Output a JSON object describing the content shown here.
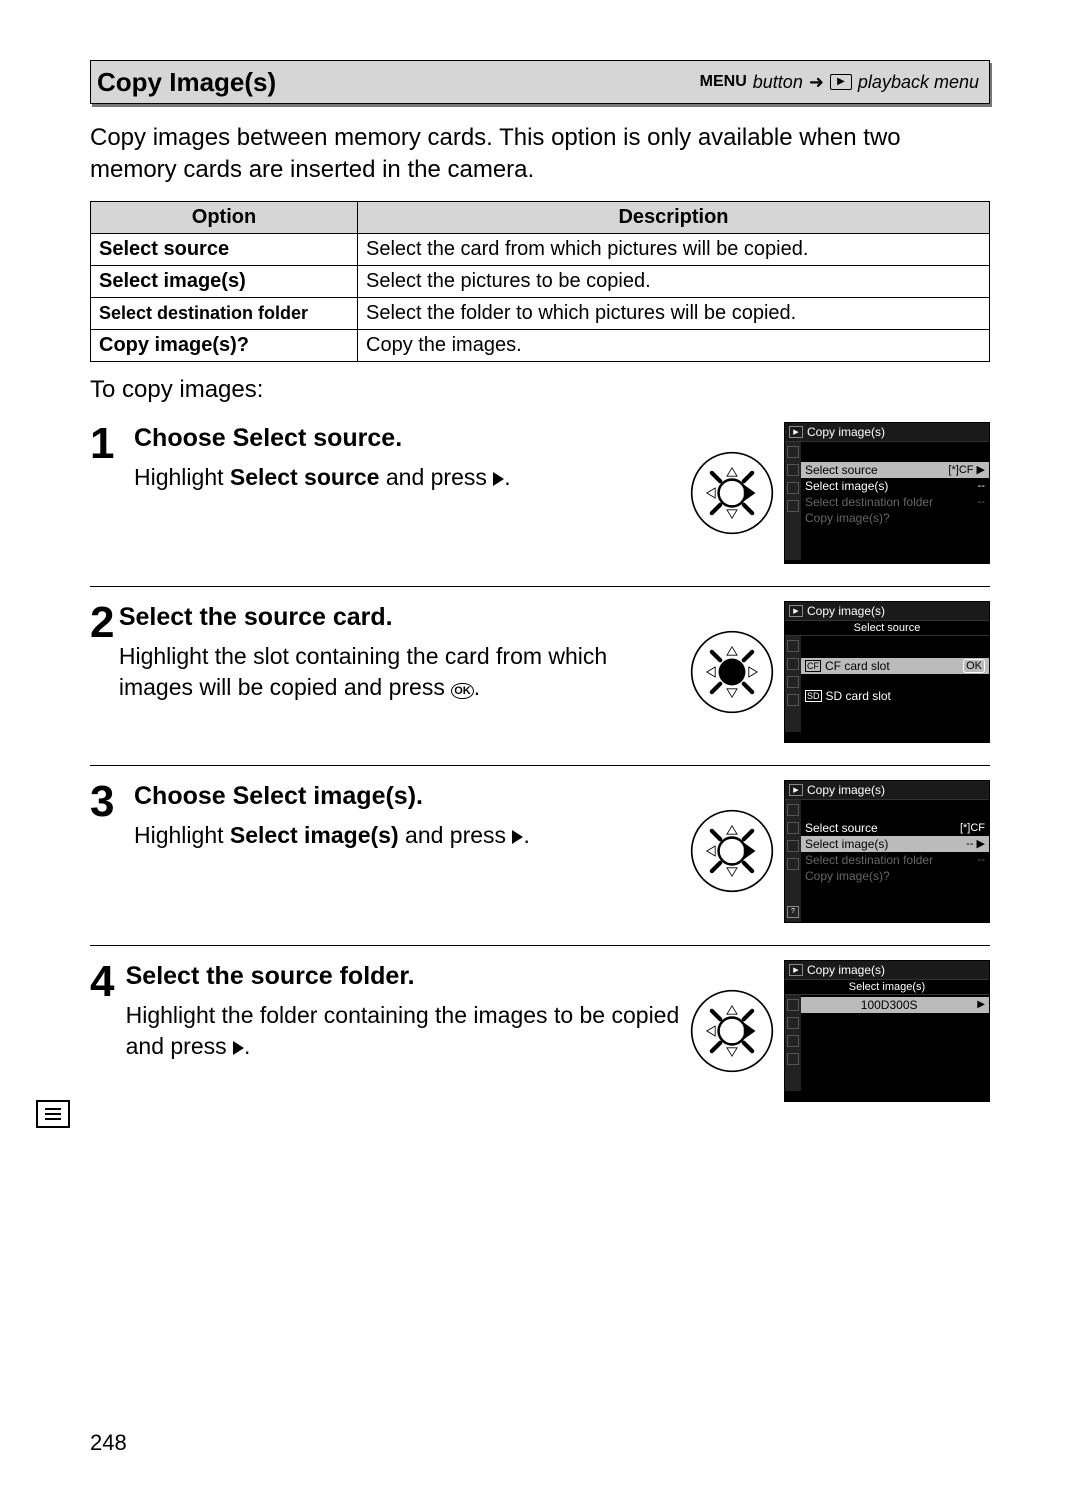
{
  "header": {
    "title": "Copy Image(s)",
    "menu_word": "MENU",
    "button_word": "button",
    "arrow": "➜",
    "playback_menu": "playback menu"
  },
  "intro": "Copy images between memory cards.  This option is only available when two memory cards are inserted in the camera.",
  "table": {
    "th_option": "Option",
    "th_desc": "Description",
    "rows": [
      {
        "opt": "Select source",
        "desc": "Select the card from which pictures will be copied."
      },
      {
        "opt": "Select image(s)",
        "desc": "Select the pictures to be copied."
      },
      {
        "opt": "Select destination folder",
        "desc": "Select the folder to which pictures will be copied."
      },
      {
        "opt": "Copy image(s)?",
        "desc": "Copy the images."
      }
    ]
  },
  "to_copy": "To copy images:",
  "steps": {
    "1": {
      "num": "1",
      "title_pre": "Choose ",
      "title_bold": "Select source",
      "title_post": ".",
      "body_pre": "Highlight ",
      "body_bold": "Select source",
      "body_post": " and press ",
      "press": "right",
      "lcd": {
        "title": "Copy image(s)",
        "rows": [
          {
            "label": "Select source",
            "val": "[*]CF ▶",
            "hi": true
          },
          {
            "label": "Select image(s)",
            "val": "--"
          },
          {
            "label": "Select destination folder",
            "val": "--",
            "dim": true
          },
          {
            "label": "Copy image(s)?",
            "val": "",
            "dim": true
          }
        ]
      }
    },
    "2": {
      "num": "2",
      "title": "Select the source card.",
      "body_pre": "Highlight the slot containing the card from which images will be copied and press ",
      "press": "ok",
      "lcd": {
        "title": "Copy image(s)",
        "subtitle": "Select source",
        "rows": [
          {
            "label": "CF card slot",
            "cf": "CF",
            "hi": true,
            "ok": true
          },
          {
            "label": "SD card slot",
            "cf": "SD"
          }
        ]
      }
    },
    "3": {
      "num": "3",
      "title_pre": "Choose ",
      "title_bold": "Select image(s)",
      "title_post": ".",
      "body_pre": "Highlight ",
      "body_bold": "Select image(s)",
      "body_post": " and press ",
      "press": "right",
      "lcd": {
        "title": "Copy image(s)",
        "rows": [
          {
            "label": "Select source",
            "val": "[*]CF"
          },
          {
            "label": "Select image(s)",
            "val": "-- ▶",
            "hi": true
          },
          {
            "label": "Select destination folder",
            "val": "--",
            "dim": true
          },
          {
            "label": "Copy image(s)?",
            "val": "",
            "dim": true
          }
        ],
        "help_icon": true
      }
    },
    "4": {
      "num": "4",
      "title": "Select the source folder.",
      "body_pre": "Highlight the folder containing the images to be copied and press ",
      "press": "right",
      "lcd": {
        "title": "Copy image(s)",
        "subtitle": "Select image(s)",
        "folder_rows": [
          {
            "label": "100D300S",
            "hi": true,
            "arrow": true
          }
        ]
      }
    }
  },
  "page_number": "248"
}
